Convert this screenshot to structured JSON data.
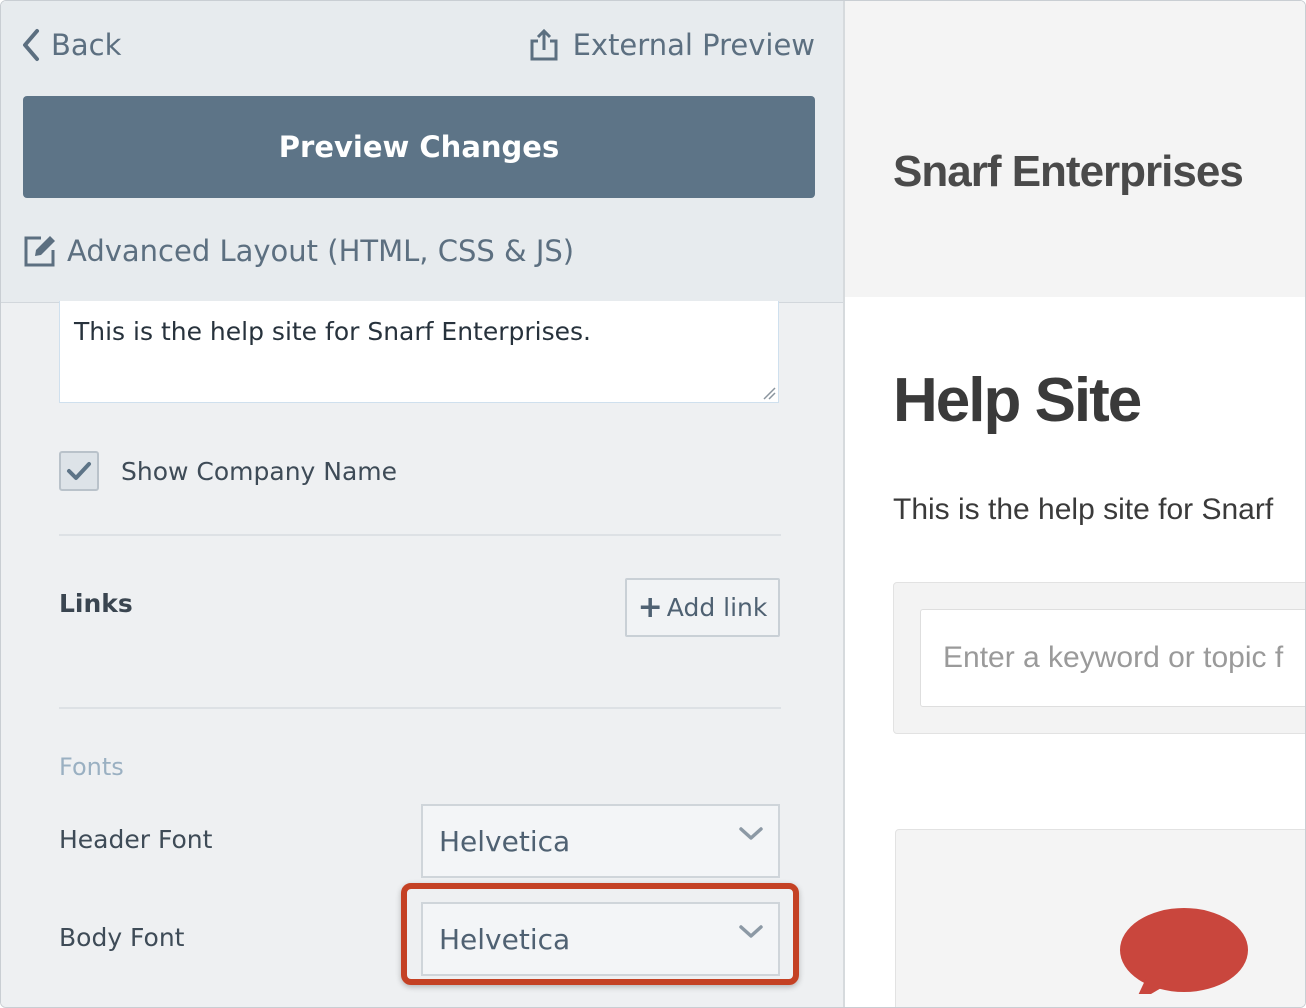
{
  "sidebar": {
    "back_label": "Back",
    "external_preview_label": "External Preview",
    "preview_button_label": "Preview Changes",
    "advanced_layout_label": "Advanced Layout (HTML, CSS & JS)",
    "description_value": "This is the help site for Snarf Enterprises.",
    "show_company_name": {
      "label": "Show Company Name",
      "checked": true
    },
    "links": {
      "label": "Links",
      "add_link_label": "Add link"
    },
    "fonts": {
      "heading": "Fonts",
      "header_font": {
        "label": "Header Font",
        "value": "Helvetica"
      },
      "body_font": {
        "label": "Body Font",
        "value": "Helvetica"
      }
    }
  },
  "preview": {
    "company_name": "Snarf Enterprises",
    "title": "Help Site",
    "description": "This is the help site for Snarf",
    "search_placeholder": "Enter a keyword or topic f"
  },
  "colors": {
    "primary_button": "#5d7487",
    "highlight": "#c44124",
    "speech_bubble": "#c9463d"
  }
}
